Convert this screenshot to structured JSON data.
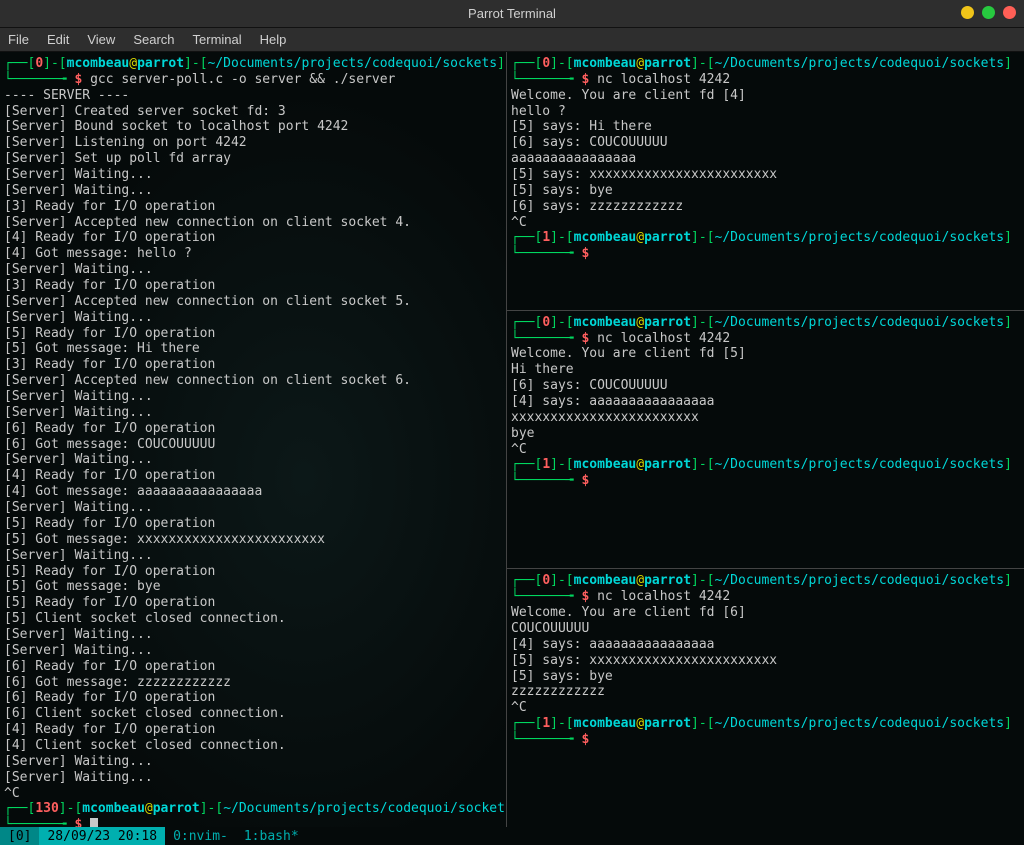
{
  "window": {
    "title": "Parrot Terminal"
  },
  "menu": {
    "items": [
      "File",
      "Edit",
      "View",
      "Search",
      "Terminal",
      "Help"
    ]
  },
  "prompt_parts": {
    "user": "mcombeau",
    "host": "parrot",
    "path": "~/Documents/projects/codequoi/sockets",
    "dollar": "$",
    "dash": "-",
    "lb": "[",
    "rb": "]",
    "at": "@",
    "corner_top": "┌──",
    "corner_bot": "└──────╼ "
  },
  "left": {
    "exit1": "0",
    "cmd": "gcc server-poll.c -o server && ./server",
    "lines": [
      "---- SERVER ----",
      "",
      "[Server] Created server socket fd: 3",
      "[Server] Bound socket to localhost port 4242",
      "[Server] Listening on port 4242",
      "[Server] Set up poll fd array",
      "[Server] Waiting...",
      "[Server] Waiting...",
      "[3] Ready for I/O operation",
      "[Server] Accepted new connection on client socket 4.",
      "[4] Ready for I/O operation",
      "[4] Got message: hello ?",
      "[Server] Waiting...",
      "[3] Ready for I/O operation",
      "[Server] Accepted new connection on client socket 5.",
      "[Server] Waiting...",
      "[5] Ready for I/O operation",
      "[5] Got message: Hi there",
      "[3] Ready for I/O operation",
      "[Server] Accepted new connection on client socket 6.",
      "[Server] Waiting...",
      "[Server] Waiting...",
      "[6] Ready for I/O operation",
      "[6] Got message: COUCOUUUUU",
      "[Server] Waiting...",
      "[4] Ready for I/O operation",
      "[4] Got message: aaaaaaaaaaaaaaaa",
      "[Server] Waiting...",
      "[5] Ready for I/O operation",
      "[5] Got message: xxxxxxxxxxxxxxxxxxxxxxxx",
      "[Server] Waiting...",
      "[5] Ready for I/O operation",
      "[5] Got message: bye",
      "[5] Ready for I/O operation",
      "[5] Client socket closed connection.",
      "[Server] Waiting...",
      "[Server] Waiting...",
      "[6] Ready for I/O operation",
      "[6] Got message: zzzzzzzzzzzz",
      "[6] Ready for I/O operation",
      "[6] Client socket closed connection.",
      "[4] Ready for I/O operation",
      "[4] Client socket closed connection.",
      "[Server] Waiting...",
      "[Server] Waiting...",
      "^C"
    ],
    "exit2": "130"
  },
  "right": {
    "p1": {
      "exit1": "0",
      "cmd": "nc localhost 4242",
      "lines": [
        "Welcome. You are client fd [4]",
        "hello ?",
        "[5] says: Hi there",
        "[6] says: COUCOUUUUU",
        "aaaaaaaaaaaaaaaa",
        "[5] says: xxxxxxxxxxxxxxxxxxxxxxxx",
        "[5] says: bye",
        "[6] says: zzzzzzzzzzzz",
        "^C"
      ],
      "exit2": "1"
    },
    "p2": {
      "exit1": "0",
      "cmd": "nc localhost 4242",
      "lines": [
        "Welcome. You are client fd [5]",
        "Hi there",
        "[6] says: COUCOUUUUU",
        "[4] says: aaaaaaaaaaaaaaaa",
        "xxxxxxxxxxxxxxxxxxxxxxxx",
        "bye",
        "^C"
      ],
      "exit2": "1"
    },
    "p3": {
      "exit1": "0",
      "cmd": "nc localhost 4242",
      "lines": [
        "Welcome. You are client fd [6]",
        "COUCOUUUUU",
        "[4] says: aaaaaaaaaaaaaaaa",
        "[5] says: xxxxxxxxxxxxxxxxxxxxxxxx",
        "[5] says: bye",
        "zzzzzzzzzzzz",
        "^C"
      ],
      "exit2": "1"
    }
  },
  "status": {
    "seg0": "[0]",
    "seg1": "28/09/23 20:18",
    "seg2": "0:nvim-",
    "seg3": "1:bash*"
  }
}
